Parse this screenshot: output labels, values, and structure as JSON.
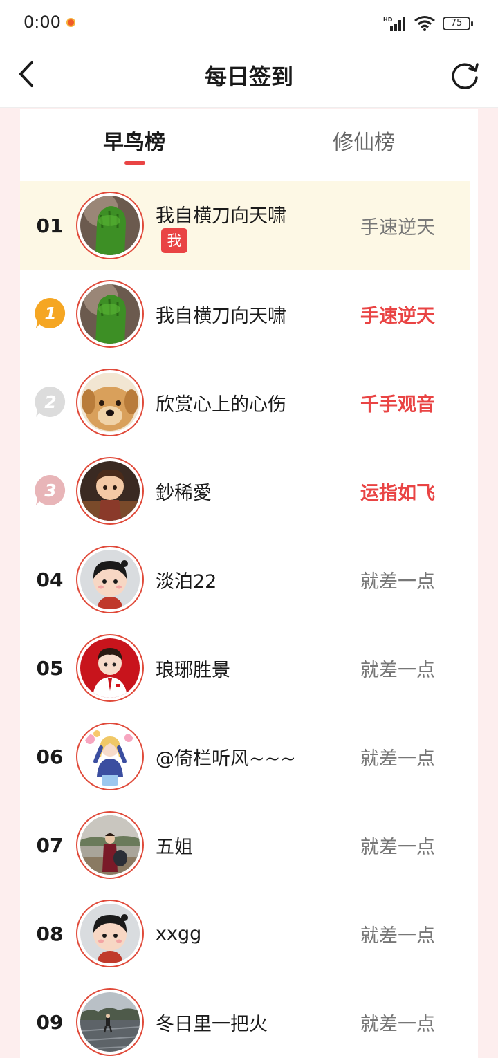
{
  "status_bar": {
    "time": "0:00",
    "battery": "75",
    "signal_label": "HD"
  },
  "nav": {
    "title": "每日签到",
    "back_icon": "chevron-left-icon",
    "refresh_icon": "refresh-icon"
  },
  "tabs": [
    {
      "label": "早鸟榜",
      "active": true
    },
    {
      "label": "修仙榜",
      "active": false
    }
  ],
  "my_entry": {
    "rank": "01",
    "name": "我自横刀向天啸",
    "badge": "我",
    "title": "手速逆天"
  },
  "entries": [
    {
      "medal": "1",
      "name": "我自横刀向天啸",
      "title": "手速逆天",
      "highlight": true
    },
    {
      "medal": "2",
      "name": "欣赏心上的心伤",
      "title": "千手观音",
      "highlight": true
    },
    {
      "medal": "3",
      "name": "鈔稀愛",
      "title": "运指如飞",
      "highlight": true
    },
    {
      "rank": "04",
      "name": "淡泊22",
      "title": "就差一点",
      "highlight": false
    },
    {
      "rank": "05",
      "name": "琅琊胜景",
      "title": "就差一点",
      "highlight": false
    },
    {
      "rank": "06",
      "name": "@倚栏听风~~~",
      "title": "就差一点",
      "highlight": false
    },
    {
      "rank": "07",
      "name": "五姐",
      "title": "就差一点",
      "highlight": false
    },
    {
      "rank": "08",
      "name": "xxgg",
      "title": "就差一点",
      "highlight": false
    },
    {
      "rank": "09",
      "name": "冬日里一把火",
      "title": "就差一点",
      "highlight": false
    }
  ],
  "colors": {
    "accent": "#e94444",
    "my_row_bg": "#fdf8e5",
    "gold": "#f5a623",
    "silver": "#d9d9d9",
    "bronze": "#e8b5b8"
  }
}
